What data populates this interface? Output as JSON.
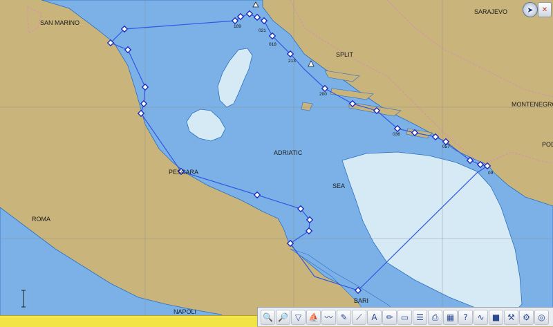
{
  "map": {
    "labels": {
      "san_marino": "SAN MARINO",
      "sarajevo": "SARAJEVO",
      "split": "SPLIT",
      "montenegro": "MONTENEGRO",
      "pod": "POD",
      "adriatic": "ADRIATIC",
      "sea": "SEA",
      "pescara": "PESCARA",
      "roma": "ROMA",
      "bari": "BARI",
      "napoli": "NAPOLI"
    },
    "waypoint_labels": {
      "w189": "189",
      "w021": "021",
      "w018": "018",
      "w213": "213",
      "w200": "200",
      "w036": "036",
      "w057": "057",
      "w09": "09"
    }
  },
  "colors": {
    "land": "#c9b47c",
    "water": "#7bb1e6",
    "shallow": "#d6eaf5",
    "route": "#2f57e3",
    "border": "#d98fae"
  },
  "toolbar": {
    "buttons": [
      {
        "icon": "zoom-in-icon",
        "glyph": "🔍"
      },
      {
        "icon": "zoom-out-icon",
        "glyph": "🔎"
      },
      {
        "icon": "funnel-icon",
        "glyph": "▽"
      },
      {
        "icon": "ship-icon",
        "glyph": "⛵"
      },
      {
        "icon": "route-icon",
        "glyph": "〰"
      },
      {
        "icon": "eraser-icon",
        "glyph": "✎"
      },
      {
        "icon": "measure-icon",
        "glyph": "⟋"
      },
      {
        "icon": "text-icon",
        "glyph": "A"
      },
      {
        "icon": "pencil-icon",
        "glyph": "✏"
      },
      {
        "icon": "folder-icon",
        "glyph": "▭"
      },
      {
        "icon": "layers-icon",
        "glyph": "☰"
      },
      {
        "icon": "print-icon",
        "glyph": "⎙"
      },
      {
        "icon": "chart-icon",
        "glyph": "▦"
      },
      {
        "icon": "help-icon",
        "glyph": "?"
      },
      {
        "icon": "graph-icon",
        "glyph": "∿"
      },
      {
        "icon": "dark-icon",
        "glyph": "■"
      },
      {
        "icon": "tools-icon",
        "glyph": "⚒"
      },
      {
        "icon": "settings-icon",
        "glyph": "⚙"
      },
      {
        "icon": "lifebuoy-icon",
        "glyph": "◎"
      }
    ]
  }
}
